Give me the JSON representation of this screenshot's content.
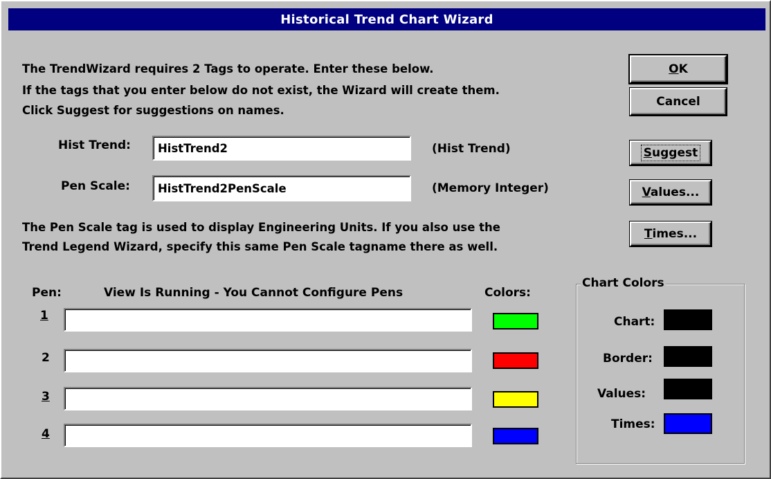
{
  "window": {
    "title": "Historical Trend Chart Wizard"
  },
  "intro": {
    "line1": "The TrendWizard requires 2 Tags to operate.  Enter these below.",
    "line2": "If the tags that you enter below do not exist, the Wizard will create them.",
    "line3": "Click Suggest for suggestions on names."
  },
  "fields": {
    "hist_trend": {
      "label": "Hist Trend:",
      "value": "HistTrend2",
      "type": "(Hist Trend)"
    },
    "pen_scale": {
      "label": "Pen Scale:",
      "value": "HistTrend2PenScale",
      "type": "(Memory Integer)"
    }
  },
  "note": {
    "line1": "The Pen Scale tag is used to display Engineering Units.  If you also use the",
    "line2": "Trend Legend Wizard, specify this same Pen Scale tagname there as well."
  },
  "buttons": {
    "ok": {
      "mnemonic": "O",
      "rest": "K"
    },
    "cancel": "Cancel",
    "suggest": {
      "mnemonic": "S",
      "rest": "uggest"
    },
    "values": {
      "mnemonic": "V",
      "rest": "alues..."
    },
    "times": {
      "mnemonic": "T",
      "rest": "imes..."
    }
  },
  "pens": {
    "header_label": "Pen:",
    "status": "View Is Running - You Cannot Configure Pens",
    "colors_label": "Colors:",
    "rows": [
      {
        "number": "1",
        "value": "",
        "color": "#00ff00"
      },
      {
        "number": "2",
        "value": "",
        "color": "#ff0000"
      },
      {
        "number": "3",
        "value": "",
        "color": "#ffff00"
      },
      {
        "number": "4",
        "value": "",
        "color": "#0000ff"
      }
    ]
  },
  "chart_colors": {
    "title": "Chart Colors",
    "items": [
      {
        "label": "Chart:",
        "color": "#000000"
      },
      {
        "label": "Border:",
        "color": "#000000"
      },
      {
        "label": "Values:",
        "color": "#000000"
      },
      {
        "label": "Times:",
        "color": "#0000ff"
      }
    ]
  }
}
